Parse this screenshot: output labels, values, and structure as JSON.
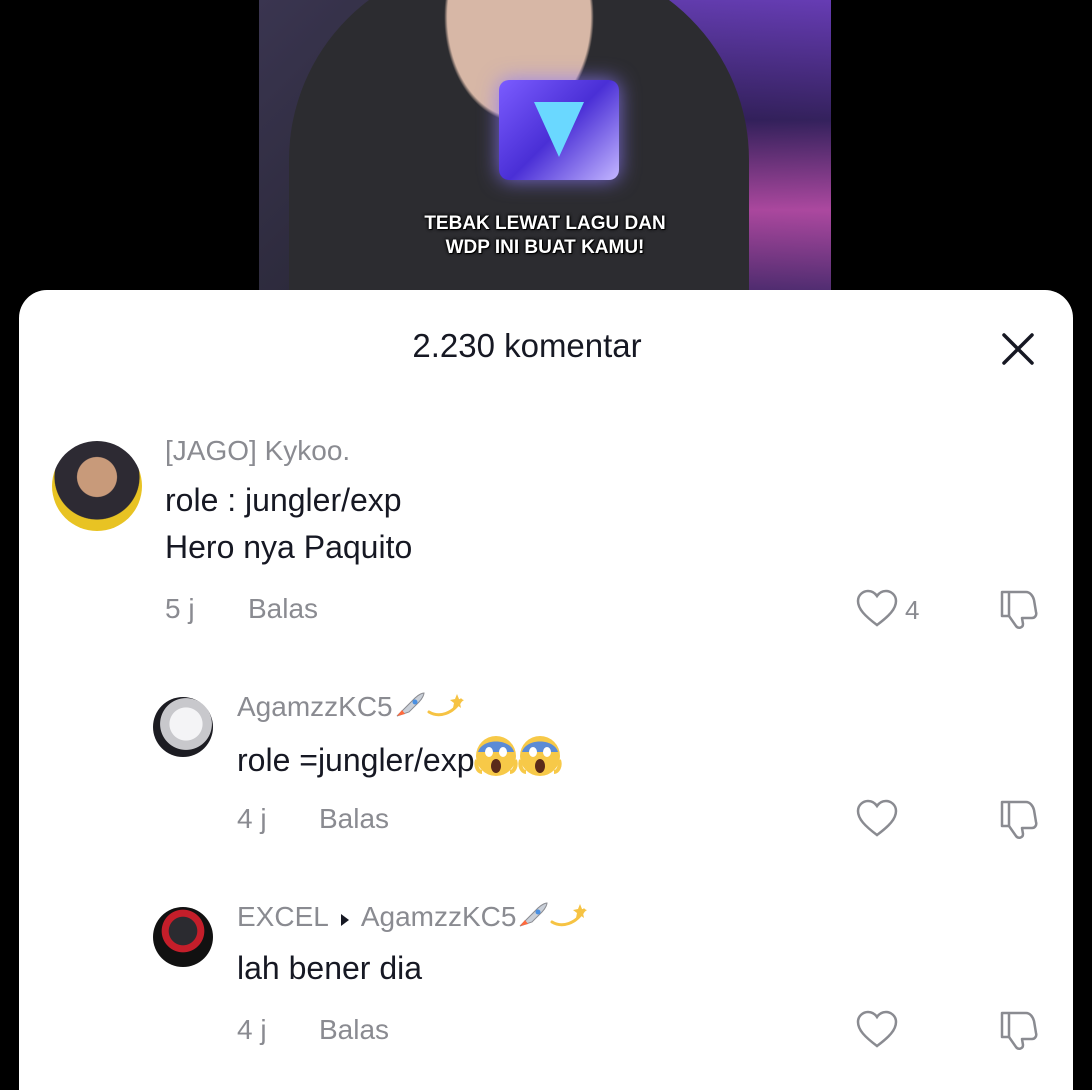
{
  "video": {
    "caption_line1": "TEBAK LEWAT LAGU DAN",
    "caption_line2": "WDP INI BUAT KAMU!"
  },
  "sheet": {
    "title": "2.230 komentar",
    "close_icon": "close-icon"
  },
  "comments": [
    {
      "username": "[JAGO] Kykoo.",
      "text_line1": "role : jungler/exp",
      "text_line2": "Hero nya Paquito",
      "time": "5 j",
      "reply_label": "Balas",
      "likes": "4"
    },
    {
      "username": "AgamzzKC5",
      "username_emojis": [
        "rocket-emoji",
        "dizzy-emoji"
      ],
      "text": "role =jungler/exp",
      "text_emojis": [
        "scream-emoji",
        "scream-emoji"
      ],
      "time": "4 j",
      "reply_label": "Balas"
    },
    {
      "username": "EXCEL",
      "reply_to": "AgamzzKC5",
      "reply_to_emojis": [
        "rocket-emoji",
        "dizzy-emoji"
      ],
      "text": "lah bener dia",
      "time": "4 j",
      "reply_label": "Balas"
    }
  ],
  "colors": {
    "sheet_bg": "#ffffff",
    "primary_text": "#161823",
    "secondary_text": "#8a8b91"
  }
}
